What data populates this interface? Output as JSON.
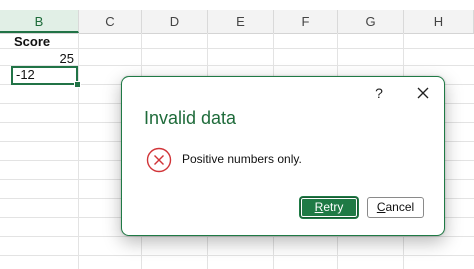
{
  "sheet": {
    "columns": [
      "B",
      "C",
      "D",
      "E",
      "F",
      "G",
      "H"
    ],
    "active_column": "B",
    "cells": {
      "b1": "Score",
      "b2": "25",
      "b3": "-12"
    }
  },
  "dialog": {
    "help_label": "?",
    "title": "Invalid data",
    "message": "Positive numbers only.",
    "retry_mnemonic": "R",
    "retry_rest": "etry",
    "cancel_mnemonic": "C",
    "cancel_rest": "ancel",
    "icon": "error-circle-x-icon",
    "accent_color": "#1f7a45",
    "error_color": "#d13438"
  }
}
